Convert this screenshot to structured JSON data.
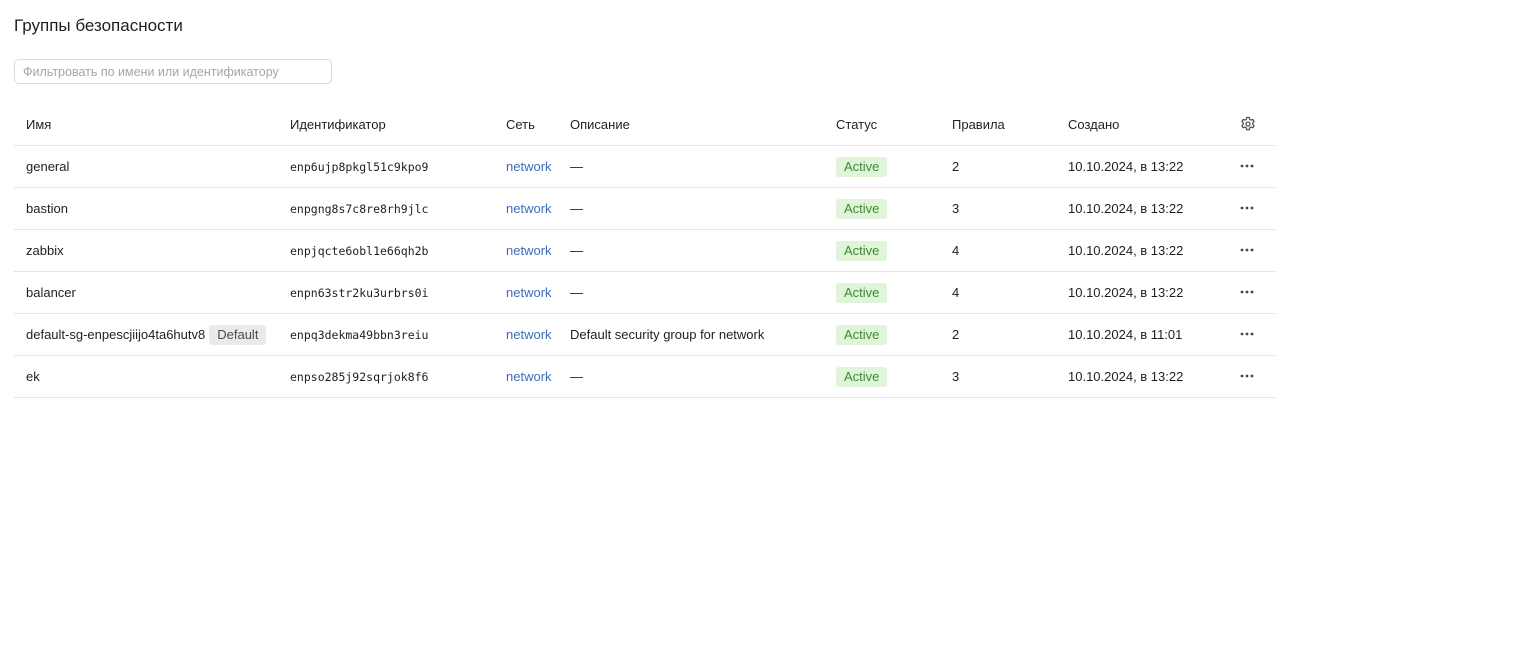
{
  "page": {
    "title": "Группы безопасности"
  },
  "filter": {
    "placeholder": "Фильтровать по имени или идентификатору",
    "value": ""
  },
  "table": {
    "columns": {
      "name": "Имя",
      "id": "Идентификатор",
      "network": "Сеть",
      "description": "Описание",
      "status": "Статус",
      "rules": "Правила",
      "created": "Создано"
    },
    "settings_icon": "gear-icon",
    "actions_icon": "more-horizontal-icon",
    "colors": {
      "link": "#3c6db8",
      "status_bg": "#dff4d9",
      "status_text": "#3d8a34",
      "default_badge_bg": "#eaeaea"
    },
    "rows": [
      {
        "name": "general",
        "badge": "",
        "id": "enp6ujp8pkgl51c9kpo9",
        "network": "network",
        "description": "—",
        "status": "Active",
        "rules": "2",
        "created": "10.10.2024, в 13:22"
      },
      {
        "name": "bastion",
        "badge": "",
        "id": "enpgng8s7c8re8rh9jlc",
        "network": "network",
        "description": "—",
        "status": "Active",
        "rules": "3",
        "created": "10.10.2024, в 13:22"
      },
      {
        "name": "zabbix",
        "badge": "",
        "id": "enpjqcte6obl1e66qh2b",
        "network": "network",
        "description": "—",
        "status": "Active",
        "rules": "4",
        "created": "10.10.2024, в 13:22"
      },
      {
        "name": "balancer",
        "badge": "",
        "id": "enpn63str2ku3urbrs0i",
        "network": "network",
        "description": "—",
        "status": "Active",
        "rules": "4",
        "created": "10.10.2024, в 13:22"
      },
      {
        "name": "default-sg-enpescjiijo4ta6hutv8",
        "badge": "Default",
        "id": "enpq3dekma49bbn3reiu",
        "network": "network",
        "description": "Default security group for network",
        "status": "Active",
        "rules": "2",
        "created": "10.10.2024, в 11:01"
      },
      {
        "name": "ek",
        "badge": "",
        "id": "enpso285j92sqrjok8f6",
        "network": "network",
        "description": "—",
        "status": "Active",
        "rules": "3",
        "created": "10.10.2024, в 13:22"
      }
    ]
  }
}
